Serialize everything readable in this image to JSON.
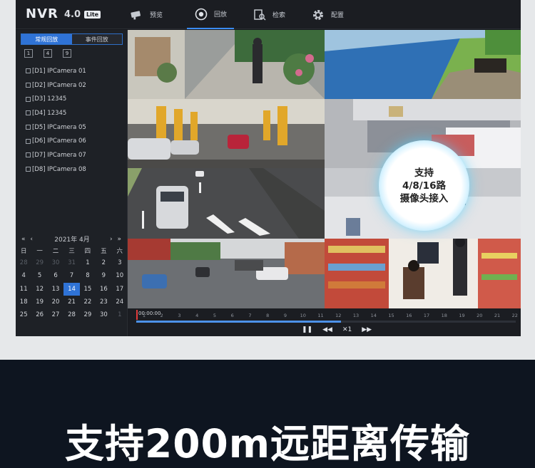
{
  "app": {
    "logo": "NVR",
    "version": "4.0",
    "edition": "Lite"
  },
  "nav": [
    {
      "label": "预览",
      "icon": "camera-icon"
    },
    {
      "label": "回放",
      "icon": "playback-icon"
    },
    {
      "label": "检索",
      "icon": "search-file-icon"
    },
    {
      "label": "配置",
      "icon": "gear-icon"
    }
  ],
  "playback_tabs": [
    {
      "label": "常规回放"
    },
    {
      "label": "事件回放"
    }
  ],
  "layout_buttons": [
    "1",
    "4",
    "9"
  ],
  "cameras": [
    "[D1] IPCamera 01",
    "[D2] IPCamera 02",
    "[D3] 12345",
    "[D4] 12345",
    "[D5] IPCamera 05",
    "[D6] IPCamera 06",
    "[D7] IPCamera 07",
    "[D8] IPCamera 08"
  ],
  "calendar": {
    "prev": "« ‹",
    "next": "› »",
    "title": "2021年 4月",
    "weekdays": [
      "日",
      "一",
      "二",
      "三",
      "四",
      "五",
      "六"
    ],
    "today": "14",
    "weeks": [
      [
        "28",
        "29",
        "30",
        "31",
        "1",
        "2",
        "3"
      ],
      [
        "4",
        "5",
        "6",
        "7",
        "8",
        "9",
        "10"
      ],
      [
        "11",
        "12",
        "13",
        "14",
        "15",
        "16",
        "17"
      ],
      [
        "18",
        "19",
        "20",
        "21",
        "22",
        "23",
        "24"
      ],
      [
        "25",
        "26",
        "27",
        "28",
        "29",
        "30",
        "1"
      ]
    ]
  },
  "overlay": {
    "line1": "支持",
    "line2": "4/8/16路",
    "line3": "摄像头接入"
  },
  "timeline": {
    "time": "00:00:00",
    "ticks": [
      "1",
      "2",
      "3",
      "4",
      "5",
      "6",
      "7",
      "8",
      "9",
      "10",
      "11",
      "12",
      "13",
      "14",
      "15",
      "16",
      "17",
      "18",
      "19",
      "20",
      "21",
      "22"
    ],
    "progress": 0.54
  },
  "controls": {
    "pause": "❚❚",
    "rewind": "◀◀",
    "speed": "✕1",
    "forward": "▶▶"
  },
  "caption": "支持200m远距离传输"
}
